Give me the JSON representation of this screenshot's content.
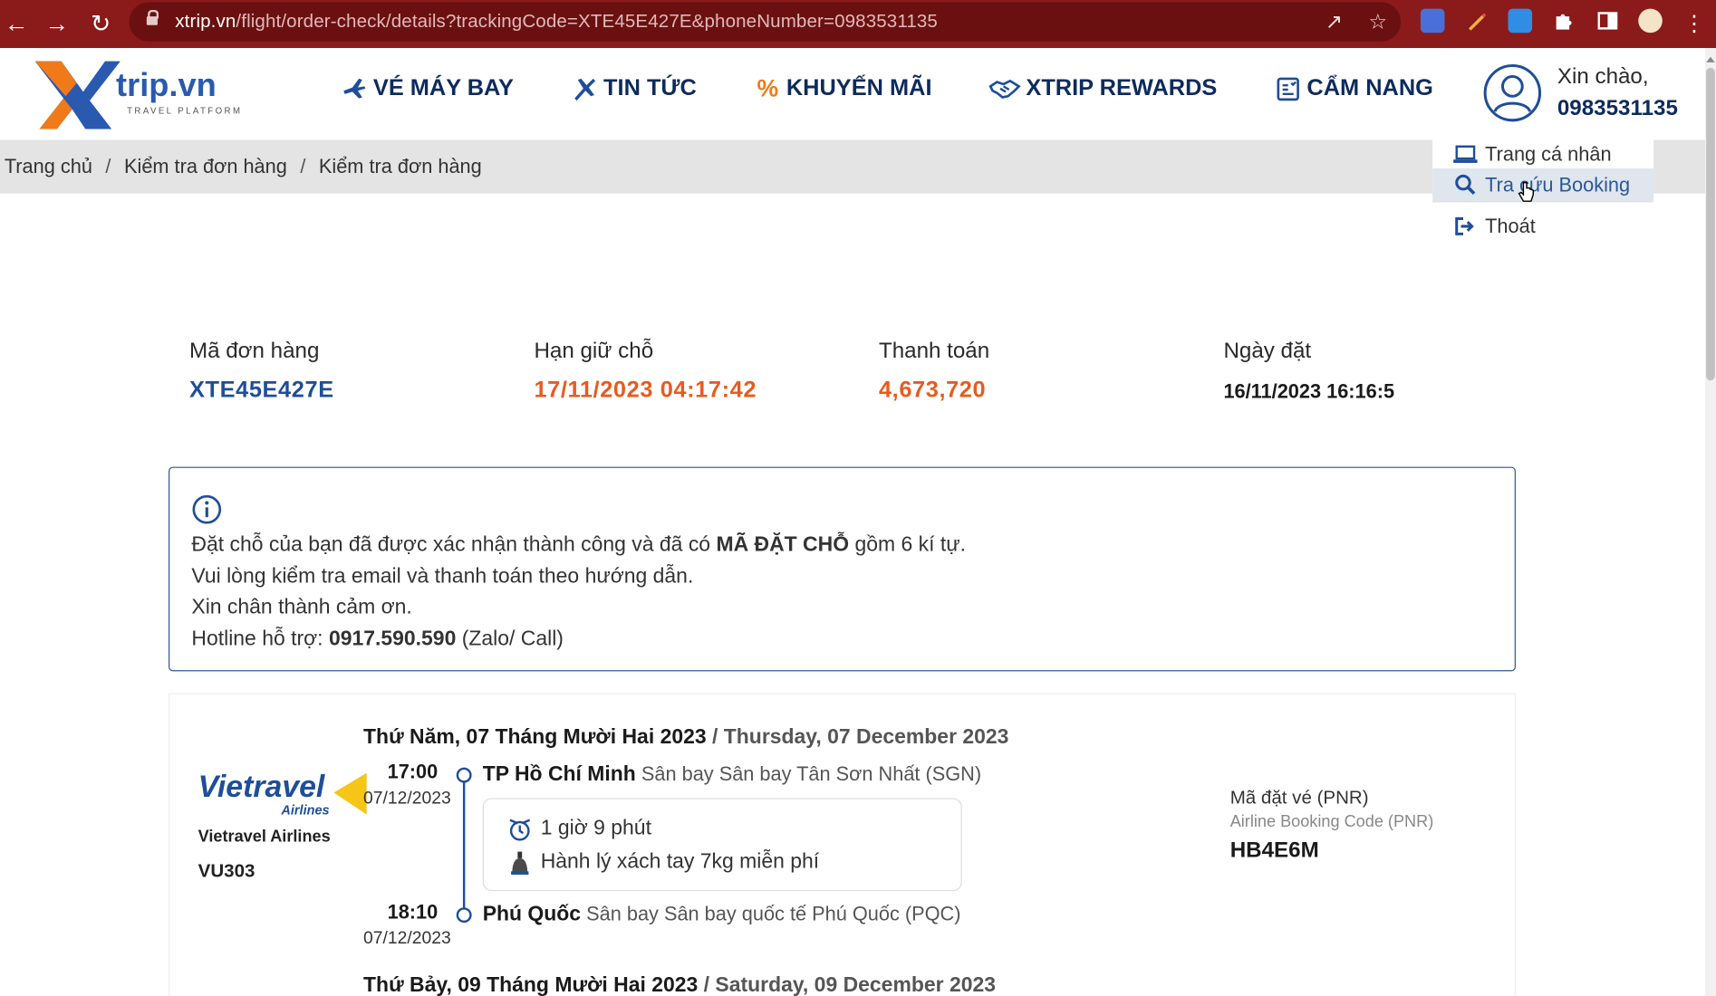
{
  "browser": {
    "url_host": "xtrip.vn",
    "url_path": "/flight/order-check/details?trackingCode=XTE45E427E&phoneNumber=0983531135"
  },
  "header": {
    "logo_text": "trip.vn",
    "logo_tagline": "TRAVEL PLATFORM",
    "nav": [
      {
        "label": "VÉ MÁY BAY",
        "icon": "plane-icon"
      },
      {
        "label": "TIN TỨC",
        "icon": "news-icon"
      },
      {
        "label": "KHUYẾN MÃI",
        "icon": "percent-icon"
      },
      {
        "label": "XTRIP REWARDS",
        "icon": "handshake-icon"
      },
      {
        "label": "CẨM NANG",
        "icon": "handbook-icon"
      }
    ],
    "user": {
      "greeting": "Xin chào,",
      "phone": "0983531135"
    }
  },
  "breadcrumb": [
    "Trang chủ",
    "Kiểm tra đơn hàng",
    "Kiểm tra đơn hàng"
  ],
  "user_menu": [
    {
      "label": "Trang cá nhân",
      "icon": "laptop-icon"
    },
    {
      "label": "Tra cứu Booking",
      "icon": "search-icon"
    },
    {
      "label": "Thoát",
      "icon": "logout-icon"
    }
  ],
  "summary": {
    "order_code_label": "Mã đơn hàng",
    "order_code": "XTE45E427E",
    "hold_label": "Hạn giữ chỗ",
    "hold_until": "17/11/2023 04:17:42",
    "payment_label": "Thanh toán",
    "payment": "4,673,720",
    "booked_label": "Ngày đặt",
    "booked_at": "16/11/2023 16:16:5"
  },
  "info": {
    "line1_pre": "Đặt chỗ của bạn đã được xác nhận thành công và đã có ",
    "line1_bold": "MÃ ĐẶT CHỖ",
    "line1_post": " gồm 6 kí tự.",
    "line2": "Vui lòng kiểm tra email và thanh toán theo hướng dẫn.",
    "line3": "Xin chân thành cảm ơn.",
    "hotline_pre": "Hotline hỗ trợ: ",
    "hotline_number": "0917.590.590",
    "hotline_post": " (Zalo/ Call)"
  },
  "flight": {
    "date_vi": "Thứ Năm, 07 Tháng Mười Hai 2023",
    "date_en": " / Thursday, 07 December 2023",
    "airline_logo_text": "Vietravel",
    "airline_logo_sub": "Airlines",
    "airline": "Vietravel Airlines",
    "flight_no": "VU303",
    "depart_time": "17:00",
    "depart_date": "07/12/2023",
    "depart_city": "TP Hồ Chí Minh",
    "depart_airport": " Sân bay Sân bay Tân Sơn Nhất (SGN)",
    "duration": "1 giờ 9 phút",
    "baggage": "Hành lý xách tay 7kg miễn phí",
    "arrive_time": "18:10",
    "arrive_date": "07/12/2023",
    "arrive_city": "Phú Quốc",
    "arrive_airport": " Sân bay Sân bay quốc tế Phú Quốc (PQC)",
    "pnr_label": "Mã đặt vé (PNR)",
    "pnr_sub": "Airline Booking Code (PNR)",
    "pnr": "HB4E6M",
    "next_date_vi": "Thứ Bảy, 09 Tháng Mười Hai 2023",
    "next_date_en": " / Saturday, 09 December 2023"
  },
  "colors": {
    "chrome": "#8b1a1a",
    "brand_navy": "#0e2b5c",
    "accent_blue": "#1f4e99",
    "accent_orange": "#ea5a1e"
  }
}
